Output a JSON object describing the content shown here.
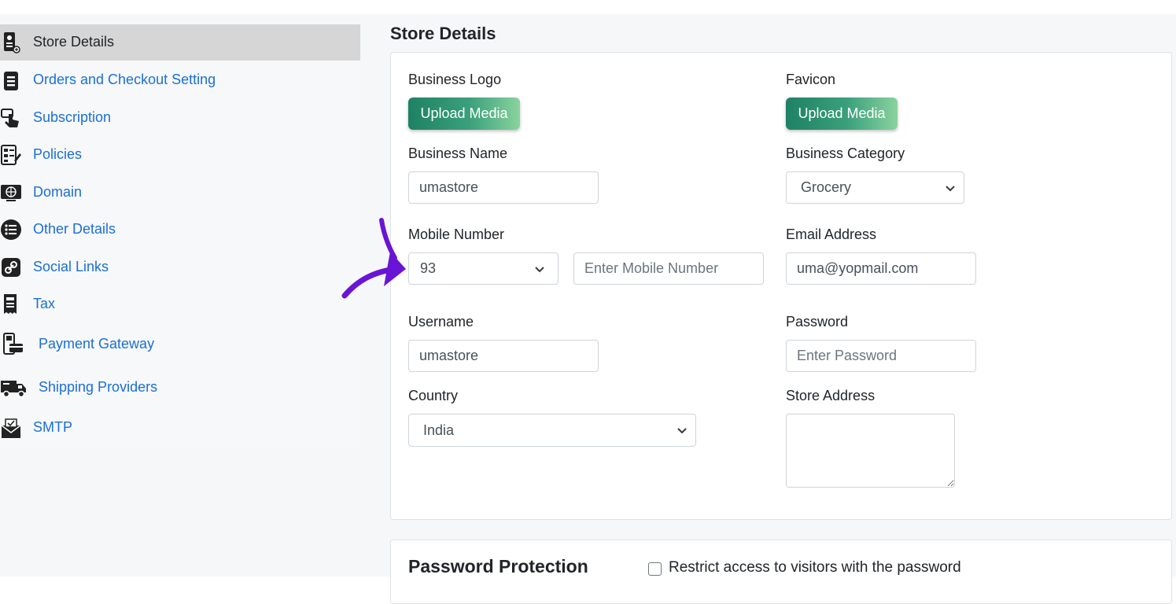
{
  "sidebar": {
    "items": [
      {
        "label": "Store Details",
        "icon": "store-icon",
        "active": true
      },
      {
        "label": "Orders and Checkout Setting",
        "icon": "document-icon"
      },
      {
        "label": "Subscription",
        "icon": "hand-pointer-icon"
      },
      {
        "label": "Policies",
        "icon": "policy-document-icon"
      },
      {
        "label": "Domain",
        "icon": "globe-monitor-icon"
      },
      {
        "label": "Other Details",
        "icon": "list-circle-icon"
      },
      {
        "label": "Social Links",
        "icon": "link-icon"
      },
      {
        "label": "Tax",
        "icon": "tax-receipt-icon"
      },
      {
        "label": "Payment Gateway",
        "icon": "payment-terminal-icon"
      },
      {
        "label": "Shipping Providers",
        "icon": "delivery-truck-icon"
      },
      {
        "label": "SMTP",
        "icon": "mail-envelope-icon"
      }
    ]
  },
  "main": {
    "title": "Store Details",
    "business_logo": {
      "label": "Business Logo",
      "button": "Upload Media"
    },
    "favicon": {
      "label": "Favicon",
      "button": "Upload Media"
    },
    "business_name": {
      "label": "Business Name",
      "value": "umastore"
    },
    "business_category": {
      "label": "Business Category",
      "value": "Grocery"
    },
    "mobile_number": {
      "label": "Mobile Number",
      "country_code": "93",
      "placeholder": "Enter Mobile Number",
      "value": ""
    },
    "email": {
      "label": "Email Address",
      "value": "uma@yopmail.com"
    },
    "username": {
      "label": "Username",
      "value": "umastore"
    },
    "password": {
      "label": "Password",
      "placeholder": "Enter Password",
      "value": ""
    },
    "country": {
      "label": "Country",
      "value": "India"
    },
    "store_address": {
      "label": "Store Address",
      "value": ""
    }
  },
  "password_protection": {
    "title": "Password Protection",
    "checkbox_label": "Restrict access to visitors with the password",
    "checked": false
  },
  "colors": {
    "link": "#1a6fd6",
    "active_bg": "#d6d6d6",
    "button_gradient_start": "#1e8163",
    "button_gradient_end": "#8ad39e",
    "annotation_arrow": "#6a14d6"
  }
}
